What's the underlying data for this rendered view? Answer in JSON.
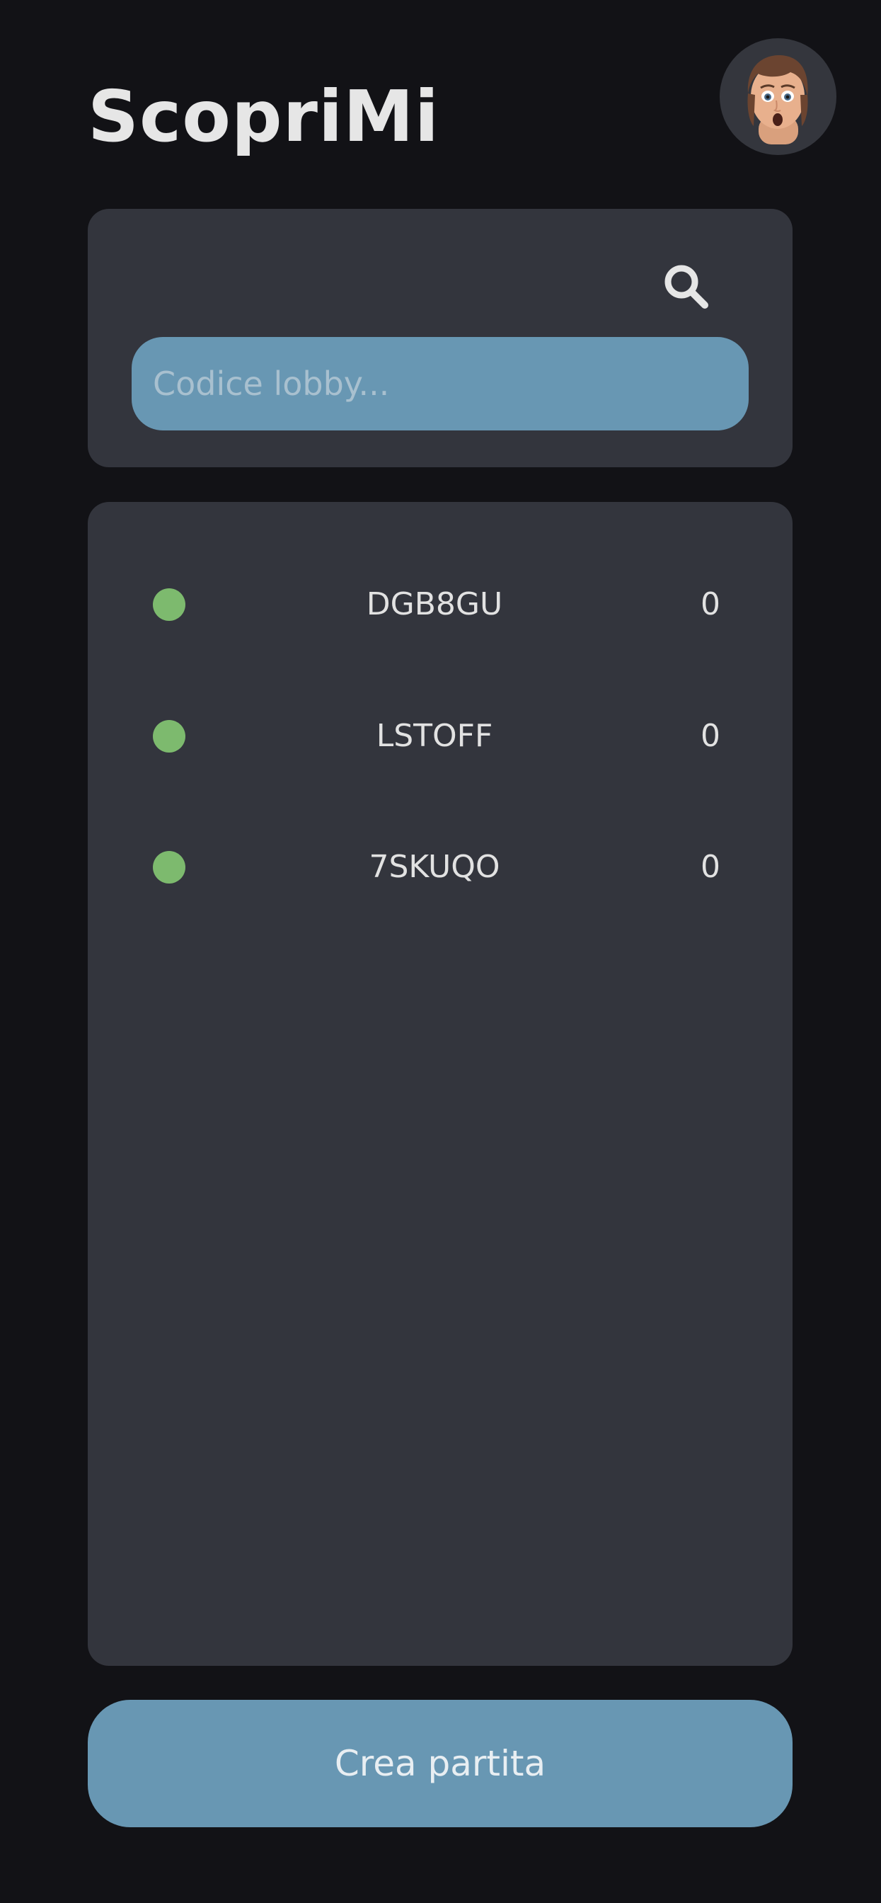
{
  "header": {
    "title": "ScopriMi",
    "avatar_icon": "memoji-avatar-icon"
  },
  "search": {
    "icon": "search-icon",
    "placeholder": "Codice lobby..."
  },
  "lobbies": [
    {
      "code": "DGB8GU",
      "players": "0",
      "status": "online"
    },
    {
      "code": "LSTOFF",
      "players": "0",
      "status": "online"
    },
    {
      "code": "7SKUQO",
      "players": "0",
      "status": "online"
    }
  ],
  "footer": {
    "create_label": "Crea partita"
  },
  "colors": {
    "background": "#121216",
    "card": "#33353d",
    "accent": "#6897b3",
    "status_online": "#7dba6e",
    "text": "#e6e6e6"
  }
}
